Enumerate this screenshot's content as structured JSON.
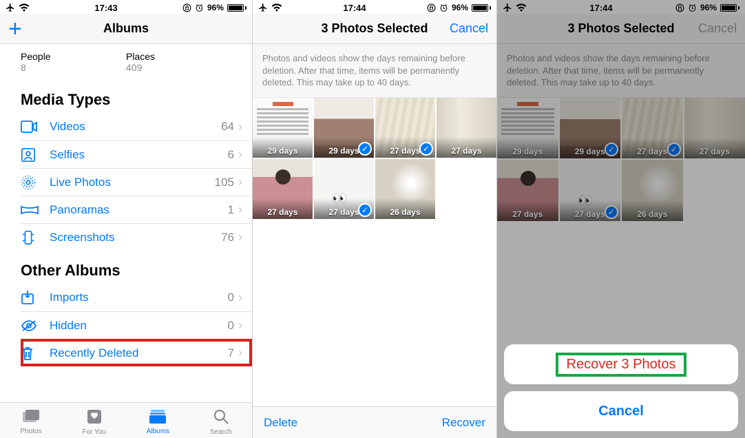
{
  "pane1": {
    "status": {
      "time": "17:43",
      "battery_pct": "96%"
    },
    "nav_title": "Albums",
    "stats": [
      {
        "label": "People",
        "value": "8"
      },
      {
        "label": "Places",
        "value": "409"
      }
    ],
    "media_types_header": "Media Types",
    "media_types": [
      {
        "key": "videos",
        "label": "Videos",
        "count": "64"
      },
      {
        "key": "selfies",
        "label": "Selfies",
        "count": "6"
      },
      {
        "key": "live",
        "label": "Live Photos",
        "count": "105"
      },
      {
        "key": "pano",
        "label": "Panoramas",
        "count": "1"
      },
      {
        "key": "screens",
        "label": "Screenshots",
        "count": "76"
      }
    ],
    "other_header": "Other Albums",
    "other": [
      {
        "key": "imports",
        "label": "Imports",
        "count": "0"
      },
      {
        "key": "hidden",
        "label": "Hidden",
        "count": "0"
      },
      {
        "key": "deleted",
        "label": "Recently Deleted",
        "count": "7"
      }
    ],
    "tabs": [
      {
        "key": "photos",
        "label": "Photos"
      },
      {
        "key": "foryou",
        "label": "For You"
      },
      {
        "key": "albums",
        "label": "Albums"
      },
      {
        "key": "search",
        "label": "Search"
      }
    ]
  },
  "pane2": {
    "status": {
      "time": "17:44",
      "battery_pct": "96%"
    },
    "nav_title": "3 Photos Selected",
    "cancel": "Cancel",
    "note": "Photos and videos show the days remaining before deletion. After that time, items will be permanently deleted. This may take up to 40 days.",
    "thumbs": [
      {
        "bg": "bg-document",
        "days": "29 days",
        "selected": false
      },
      {
        "bg": "bg-sweater",
        "days": "29 days",
        "selected": true
      },
      {
        "bg": "bg-linen",
        "days": "27 days",
        "selected": true
      },
      {
        "bg": "bg-curtain",
        "days": "27 days",
        "selected": false
      },
      {
        "bg": "bg-pink",
        "days": "27 days",
        "selected": false
      },
      {
        "bg": "bg-white",
        "days": "27 days",
        "selected": true
      },
      {
        "bg": "bg-ceiling",
        "days": "26 days",
        "selected": false
      }
    ],
    "toolbar": {
      "delete": "Delete",
      "recover": "Recover"
    }
  },
  "pane3": {
    "status": {
      "time": "17:44",
      "battery_pct": "96%"
    },
    "nav_title": "3 Photos Selected",
    "cancel": "Cancel",
    "note": "Photos and videos show the days remaining before deletion. After that time, items will be permanently deleted. This may take up to 40 days.",
    "thumbs": [
      {
        "bg": "bg-document",
        "days": "29 days",
        "selected": false
      },
      {
        "bg": "bg-sweater",
        "days": "29 days",
        "selected": true
      },
      {
        "bg": "bg-linen",
        "days": "27 days",
        "selected": true
      },
      {
        "bg": "bg-curtain",
        "days": "27 days",
        "selected": false
      },
      {
        "bg": "bg-pink",
        "days": "27 days",
        "selected": false
      },
      {
        "bg": "bg-white",
        "days": "27 days",
        "selected": true
      },
      {
        "bg": "bg-ceiling",
        "days": "26 days",
        "selected": false
      }
    ],
    "sheet": {
      "recover": "Recover 3 Photos",
      "cancel": "Cancel"
    }
  }
}
